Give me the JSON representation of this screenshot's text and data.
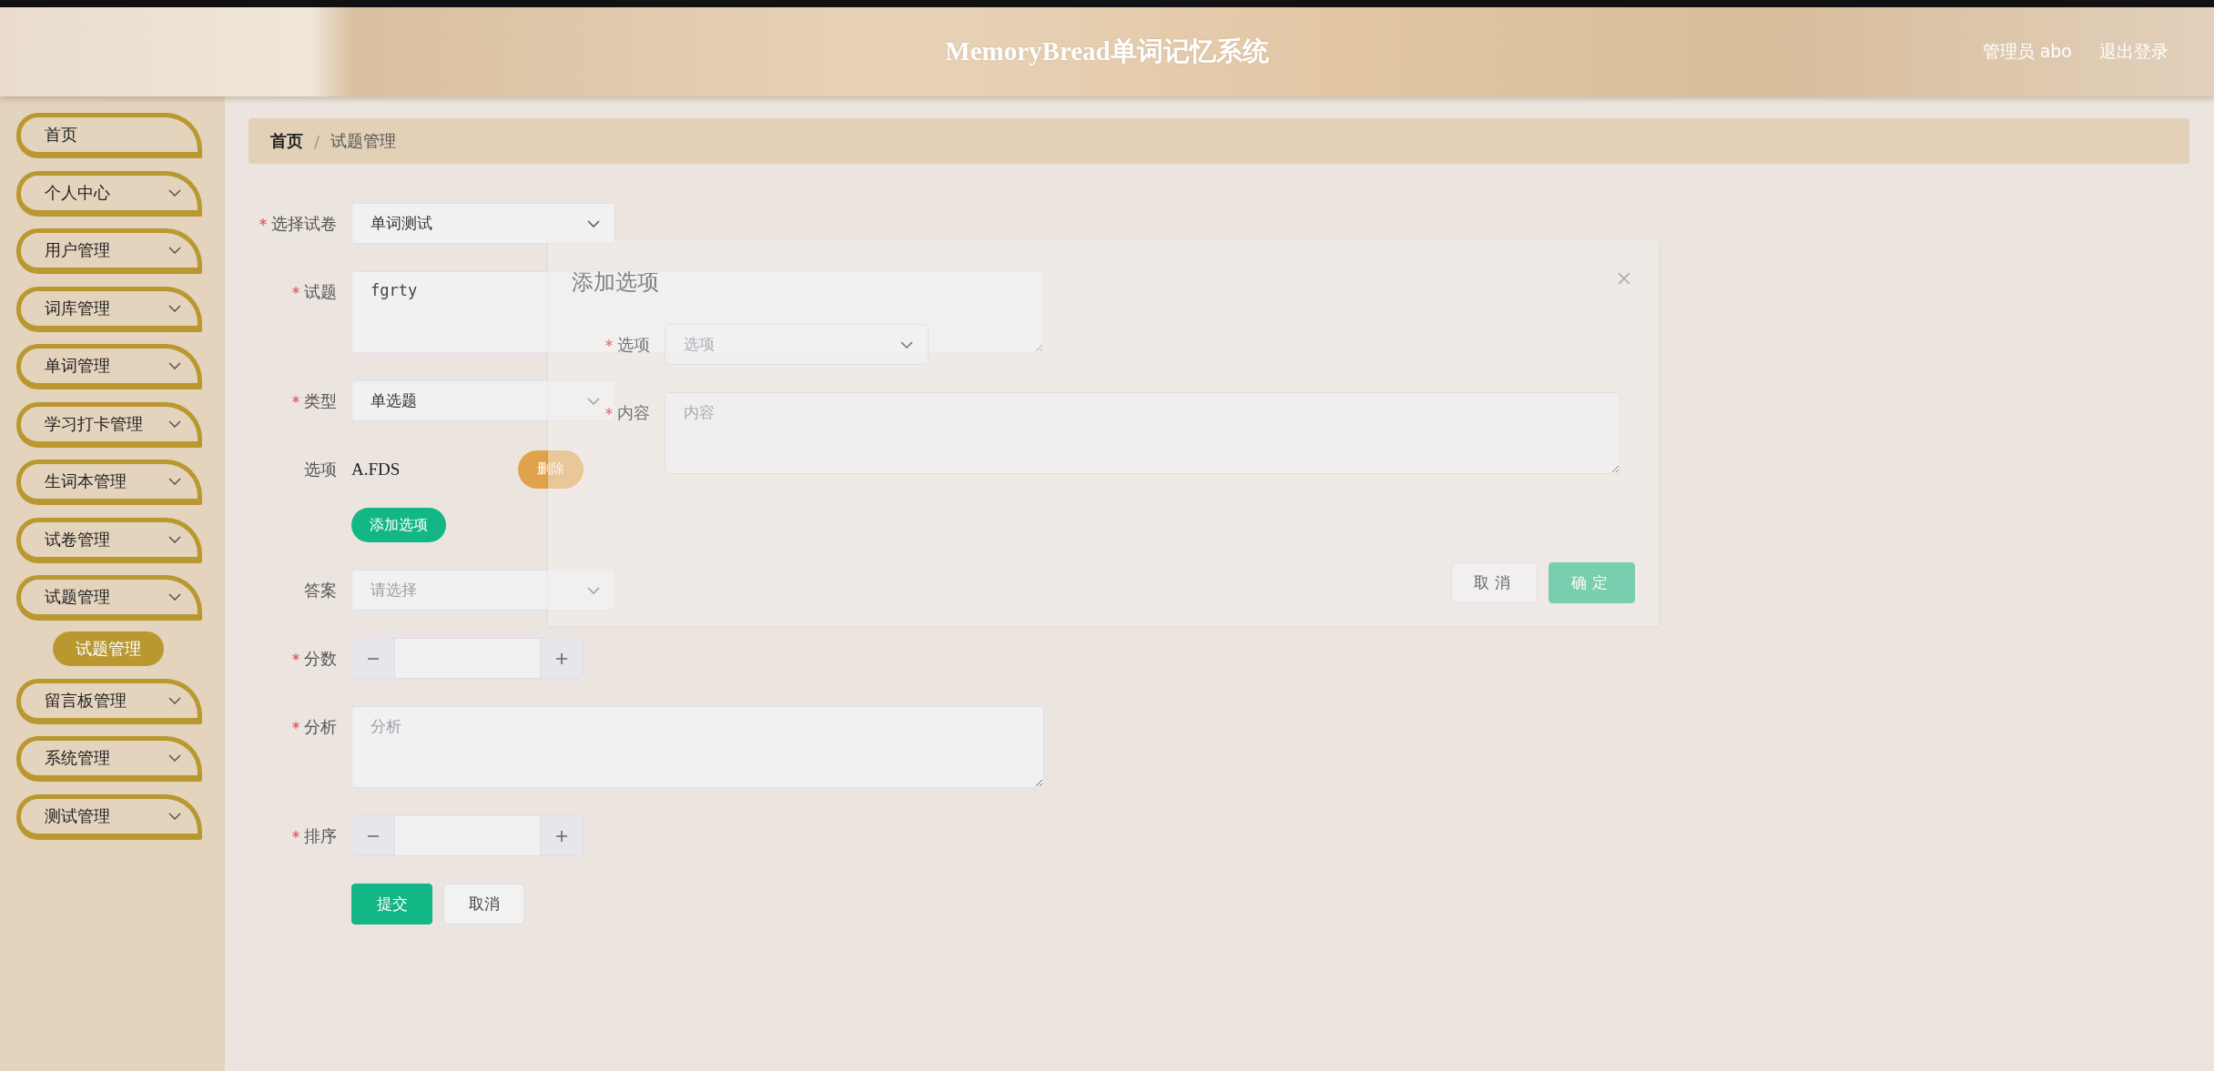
{
  "header": {
    "title": "MemoryBread单词记忆系统",
    "user": "管理员 abo",
    "logout": "退出登录"
  },
  "sidebar": {
    "items": [
      {
        "label": "首页",
        "kind": "link"
      },
      {
        "label": "个人中心",
        "kind": "menu"
      },
      {
        "label": "用户管理",
        "kind": "menu"
      },
      {
        "label": "词库管理",
        "kind": "menu"
      },
      {
        "label": "单词管理",
        "kind": "menu"
      },
      {
        "label": "学习打卡管理",
        "kind": "menu"
      },
      {
        "label": "生词本管理",
        "kind": "menu"
      },
      {
        "label": "试卷管理",
        "kind": "menu"
      },
      {
        "label": "试题管理",
        "kind": "menu",
        "children": [
          {
            "label": "试题管理",
            "selected": true
          }
        ]
      },
      {
        "label": "留言板管理",
        "kind": "menu"
      },
      {
        "label": "系统管理",
        "kind": "menu"
      },
      {
        "label": "测试管理",
        "kind": "menu"
      }
    ]
  },
  "breadcrumb": {
    "separator": "/",
    "items": [
      "首页",
      "试题管理"
    ]
  },
  "form": {
    "fields": [
      {
        "kind": "select",
        "label": "选择试卷",
        "required": true,
        "value": "单词测试"
      },
      {
        "kind": "textarea",
        "label": "试题",
        "required": true,
        "value": "fgrty"
      },
      {
        "kind": "select",
        "label": "类型",
        "required": true,
        "value": "单选题"
      },
      {
        "kind": "options",
        "label": "选项",
        "required": false,
        "options": [
          {
            "text": "A.FDS",
            "action": "删除"
          }
        ],
        "add_button": "添加选项"
      },
      {
        "kind": "select",
        "label": "答案",
        "required": false,
        "placeholder": "请选择"
      },
      {
        "kind": "number",
        "label": "分数",
        "required": true
      },
      {
        "kind": "textarea",
        "label": "分析",
        "required": true,
        "placeholder": "分析"
      },
      {
        "kind": "number",
        "label": "排序",
        "required": true
      }
    ],
    "buttons": [
      {
        "label": "提交",
        "kind": "primary"
      },
      {
        "label": "取消",
        "kind": "default"
      }
    ]
  },
  "dialog": {
    "title": "添加选项",
    "fields": [
      {
        "kind": "select",
        "label": "选项",
        "required": true,
        "placeholder": "选项"
      },
      {
        "kind": "textarea",
        "label": "内容",
        "required": true,
        "placeholder": "内容"
      }
    ],
    "buttons": [
      {
        "label": "取消",
        "kind": "default"
      },
      {
        "label": "确定",
        "kind": "primary"
      }
    ]
  }
}
